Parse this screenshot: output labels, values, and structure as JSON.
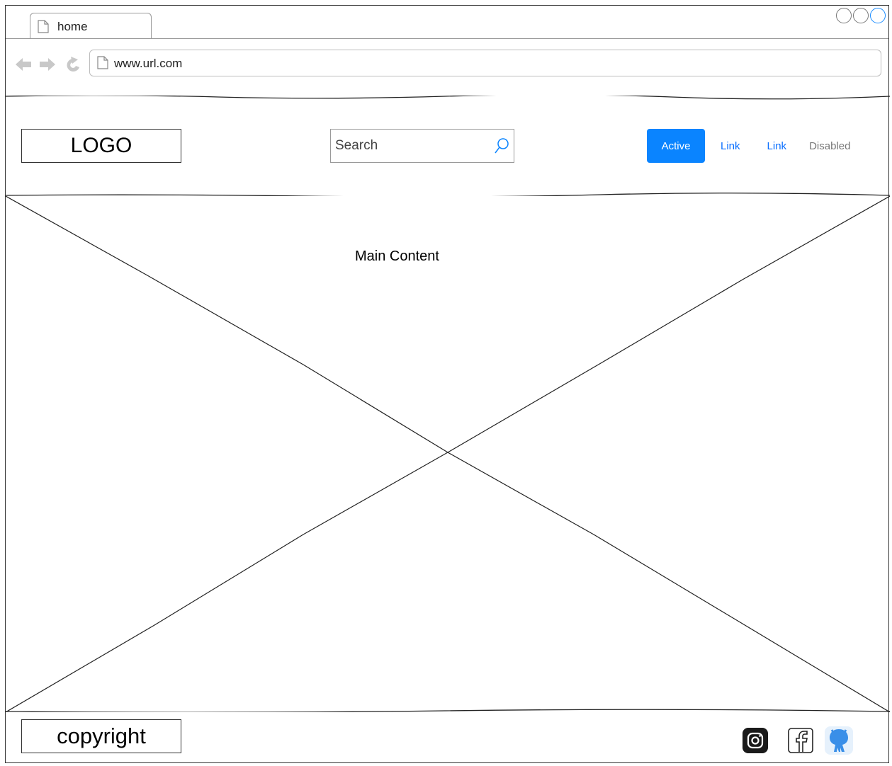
{
  "browser": {
    "tab_title": "home",
    "url": "www.url.com"
  },
  "header": {
    "logo": "LOGO",
    "search_placeholder": "Search",
    "nav": {
      "active": "Active",
      "link1": "Link",
      "link2": "Link",
      "disabled": "Disabled"
    }
  },
  "main": {
    "title": "Main Content"
  },
  "footer": {
    "copyright": "copyright",
    "icons": [
      "instagram-icon",
      "facebook-icon",
      "github-icon"
    ]
  },
  "colors": {
    "accent": "#0a84ff",
    "link": "#0a6fff",
    "disabled": "#777777",
    "border": "#333333"
  }
}
